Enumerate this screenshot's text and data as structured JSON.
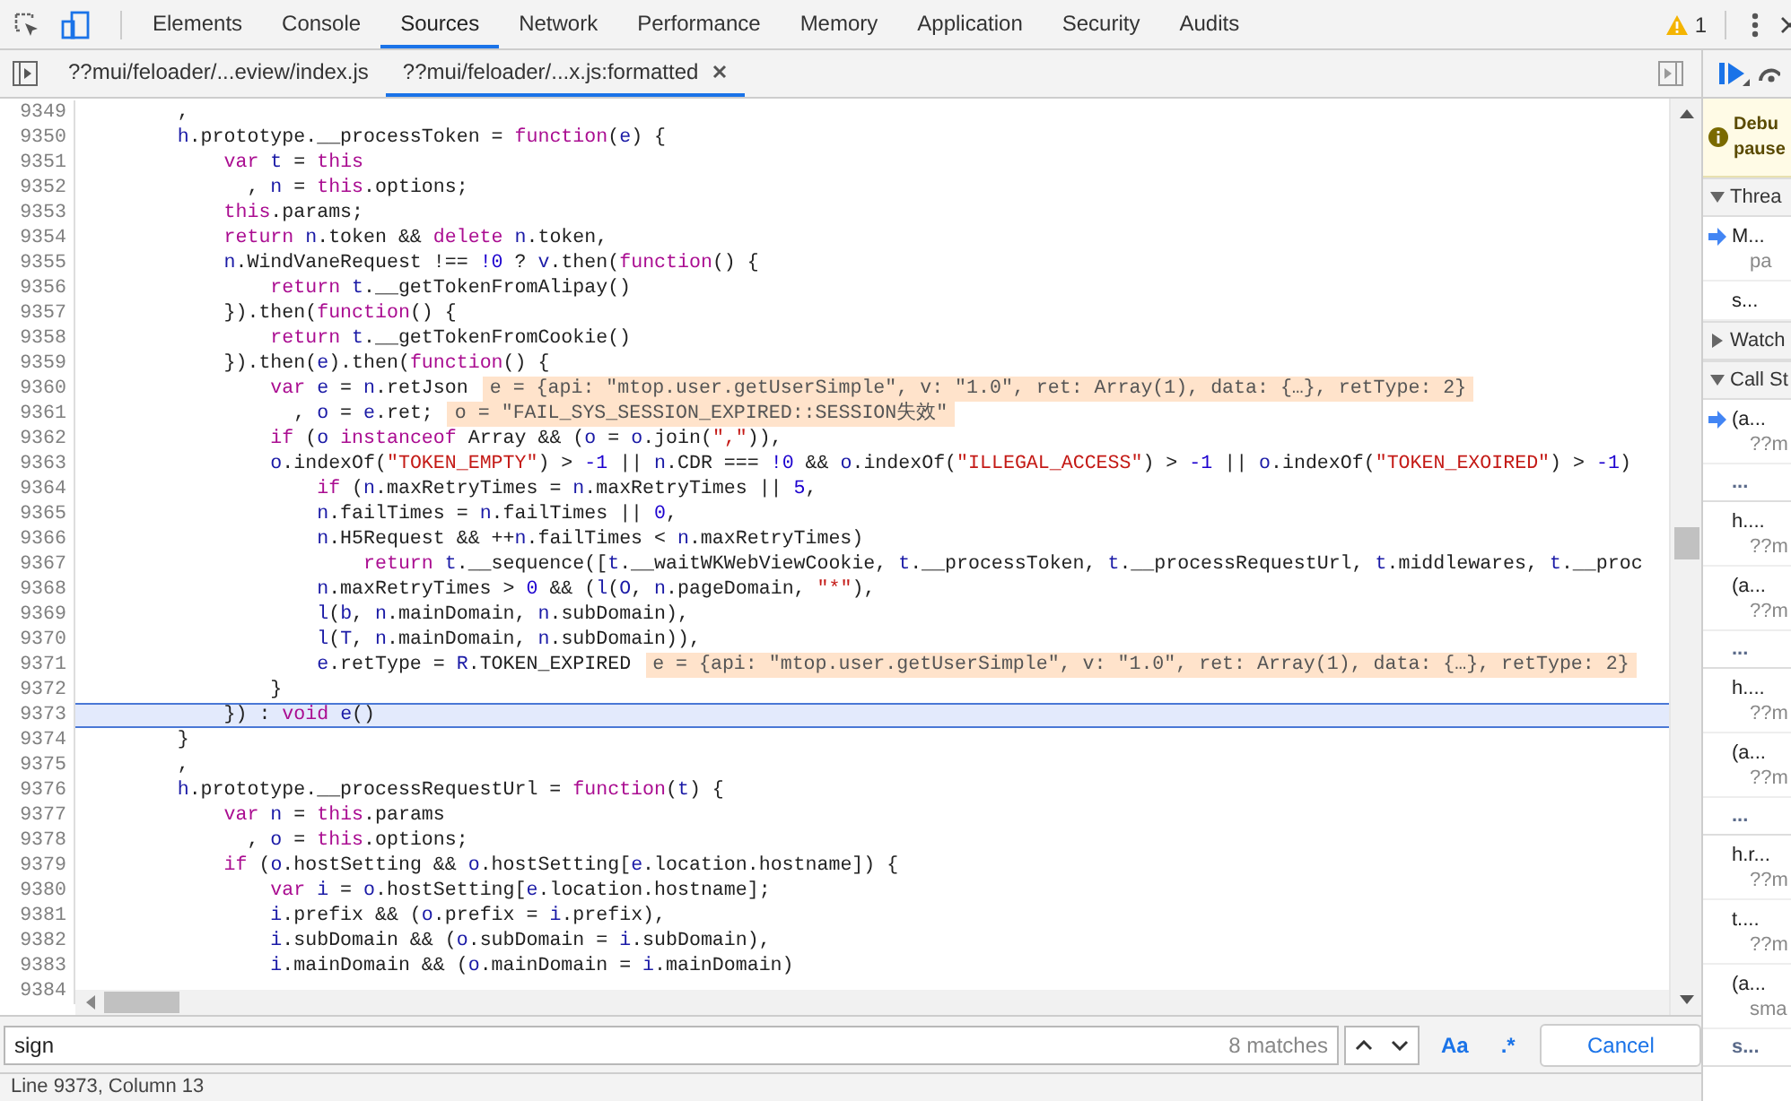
{
  "toolbar": {
    "device_mode_on": true,
    "tabs": [
      {
        "label": "Elements",
        "selected": false
      },
      {
        "label": "Console",
        "selected": false
      },
      {
        "label": "Sources",
        "selected": true
      },
      {
        "label": "Network",
        "selected": false
      },
      {
        "label": "Performance",
        "selected": false
      },
      {
        "label": "Memory",
        "selected": false
      },
      {
        "label": "Application",
        "selected": false
      },
      {
        "label": "Security",
        "selected": false
      },
      {
        "label": "Audits",
        "selected": false
      }
    ],
    "warning_count": "1"
  },
  "file_tabs": [
    {
      "label": "??mui/feloader/...eview/index.js",
      "selected": false
    },
    {
      "label": "??mui/feloader/...x.js:formatted",
      "selected": true
    }
  ],
  "code": [
    {
      "number": "9349",
      "current": false,
      "tokens": [
        {
          "kind": "p",
          "text": "        ,"
        }
      ]
    },
    {
      "number": "9350",
      "current": false,
      "tokens": [
        {
          "kind": "v",
          "text": "        h"
        },
        {
          "kind": "p",
          "text": ".prototype.__processToken = "
        },
        {
          "kind": "k",
          "text": "function"
        },
        {
          "kind": "p",
          "text": "("
        },
        {
          "kind": "v",
          "text": "e"
        },
        {
          "kind": "p",
          "text": ") {"
        }
      ]
    },
    {
      "number": "9351",
      "current": false,
      "tokens": [
        {
          "kind": "k",
          "text": "            var "
        },
        {
          "kind": "v",
          "text": "t"
        },
        {
          "kind": "p",
          "text": " = "
        },
        {
          "kind": "k",
          "text": "this"
        }
      ]
    },
    {
      "number": "9352",
      "current": false,
      "tokens": [
        {
          "kind": "p",
          "text": "              , "
        },
        {
          "kind": "v",
          "text": "n"
        },
        {
          "kind": "p",
          "text": " = "
        },
        {
          "kind": "k",
          "text": "this"
        },
        {
          "kind": "p",
          "text": ".options;"
        }
      ]
    },
    {
      "number": "9353",
      "current": false,
      "tokens": [
        {
          "kind": "k",
          "text": "            this"
        },
        {
          "kind": "p",
          "text": ".params;"
        }
      ]
    },
    {
      "number": "9354",
      "current": false,
      "tokens": [
        {
          "kind": "k",
          "text": "            return "
        },
        {
          "kind": "v",
          "text": "n"
        },
        {
          "kind": "p",
          "text": ".token && "
        },
        {
          "kind": "k",
          "text": "delete "
        },
        {
          "kind": "v",
          "text": "n"
        },
        {
          "kind": "p",
          "text": ".token,"
        }
      ]
    },
    {
      "number": "9355",
      "current": false,
      "tokens": [
        {
          "kind": "v",
          "text": "            n"
        },
        {
          "kind": "p",
          "text": ".WindVaneRequest !== "
        },
        {
          "kind": "n",
          "text": "!0"
        },
        {
          "kind": "p",
          "text": " ? "
        },
        {
          "kind": "v",
          "text": "v"
        },
        {
          "kind": "p",
          "text": ".then("
        },
        {
          "kind": "k",
          "text": "function"
        },
        {
          "kind": "p",
          "text": "() {"
        }
      ]
    },
    {
      "number": "9356",
      "current": false,
      "tokens": [
        {
          "kind": "k",
          "text": "                return "
        },
        {
          "kind": "v",
          "text": "t"
        },
        {
          "kind": "p",
          "text": ".__getTokenFromAlipay()"
        }
      ]
    },
    {
      "number": "9357",
      "current": false,
      "tokens": [
        {
          "kind": "p",
          "text": "            }).then("
        },
        {
          "kind": "k",
          "text": "function"
        },
        {
          "kind": "p",
          "text": "() {"
        }
      ]
    },
    {
      "number": "9358",
      "current": false,
      "tokens": [
        {
          "kind": "k",
          "text": "                return "
        },
        {
          "kind": "v",
          "text": "t"
        },
        {
          "kind": "p",
          "text": ".__getTokenFromCookie()"
        }
      ]
    },
    {
      "number": "9359",
      "current": false,
      "tokens": [
        {
          "kind": "p",
          "text": "            }).then("
        },
        {
          "kind": "v",
          "text": "e"
        },
        {
          "kind": "p",
          "text": ").then("
        },
        {
          "kind": "k",
          "text": "function"
        },
        {
          "kind": "p",
          "text": "() {"
        }
      ]
    },
    {
      "number": "9360",
      "current": false,
      "tokens": [
        {
          "kind": "k",
          "text": "                var "
        },
        {
          "kind": "v",
          "text": "e"
        },
        {
          "kind": "p",
          "text": " = "
        },
        {
          "kind": "v",
          "text": "n"
        },
        {
          "kind": "p",
          "text": ".retJson"
        }
      ],
      "inline_value": "e = {api: \"mtop.user.getUserSimple\", v: \"1.0\", ret: Array(1), data: {…}, retType: 2}"
    },
    {
      "number": "9361",
      "current": false,
      "tokens": [
        {
          "kind": "p",
          "text": "                  , "
        },
        {
          "kind": "v",
          "text": "o"
        },
        {
          "kind": "p",
          "text": " = "
        },
        {
          "kind": "v",
          "text": "e"
        },
        {
          "kind": "p",
          "text": ".ret;"
        }
      ],
      "inline_value": "o = \"FAIL_SYS_SESSION_EXPIRED::SESSION失效\""
    },
    {
      "number": "9362",
      "current": false,
      "tokens": [
        {
          "kind": "k",
          "text": "                if"
        },
        {
          "kind": "p",
          "text": " ("
        },
        {
          "kind": "v",
          "text": "o "
        },
        {
          "kind": "k",
          "text": "instanceof"
        },
        {
          "kind": "p",
          "text": " Array && ("
        },
        {
          "kind": "v",
          "text": "o"
        },
        {
          "kind": "p",
          "text": " = "
        },
        {
          "kind": "v",
          "text": "o"
        },
        {
          "kind": "p",
          "text": ".join("
        },
        {
          "kind": "s",
          "text": "\",\""
        },
        {
          "kind": "p",
          "text": ")),"
        }
      ]
    },
    {
      "number": "9363",
      "current": false,
      "tokens": [
        {
          "kind": "v",
          "text": "                o"
        },
        {
          "kind": "p",
          "text": ".indexOf("
        },
        {
          "kind": "s",
          "text": "\"TOKEN_EMPTY\""
        },
        {
          "kind": "p",
          "text": ") > "
        },
        {
          "kind": "n",
          "text": "-1"
        },
        {
          "kind": "p",
          "text": " || "
        },
        {
          "kind": "v",
          "text": "n"
        },
        {
          "kind": "p",
          "text": ".CDR === "
        },
        {
          "kind": "n",
          "text": "!0"
        },
        {
          "kind": "p",
          "text": " && "
        },
        {
          "kind": "v",
          "text": "o"
        },
        {
          "kind": "p",
          "text": ".indexOf("
        },
        {
          "kind": "s",
          "text": "\"ILLEGAL_ACCESS\""
        },
        {
          "kind": "p",
          "text": ") > "
        },
        {
          "kind": "n",
          "text": "-1"
        },
        {
          "kind": "p",
          "text": " || "
        },
        {
          "kind": "v",
          "text": "o"
        },
        {
          "kind": "p",
          "text": ".indexOf("
        },
        {
          "kind": "s",
          "text": "\"TOKEN_EXOIRED\""
        },
        {
          "kind": "p",
          "text": ") > "
        },
        {
          "kind": "n",
          "text": "-1"
        },
        {
          "kind": "p",
          "text": ")"
        }
      ]
    },
    {
      "number": "9364",
      "current": false,
      "tokens": [
        {
          "kind": "k",
          "text": "                    if"
        },
        {
          "kind": "p",
          "text": " ("
        },
        {
          "kind": "v",
          "text": "n"
        },
        {
          "kind": "p",
          "text": ".maxRetryTimes = "
        },
        {
          "kind": "v",
          "text": "n"
        },
        {
          "kind": "p",
          "text": ".maxRetryTimes || "
        },
        {
          "kind": "n",
          "text": "5"
        },
        {
          "kind": "p",
          "text": ","
        }
      ]
    },
    {
      "number": "9365",
      "current": false,
      "tokens": [
        {
          "kind": "v",
          "text": "                    n"
        },
        {
          "kind": "p",
          "text": ".failTimes = "
        },
        {
          "kind": "v",
          "text": "n"
        },
        {
          "kind": "p",
          "text": ".failTimes || "
        },
        {
          "kind": "n",
          "text": "0"
        },
        {
          "kind": "p",
          "text": ","
        }
      ]
    },
    {
      "number": "9366",
      "current": false,
      "tokens": [
        {
          "kind": "v",
          "text": "                    n"
        },
        {
          "kind": "p",
          "text": ".H5Request && ++"
        },
        {
          "kind": "v",
          "text": "n"
        },
        {
          "kind": "p",
          "text": ".failTimes < "
        },
        {
          "kind": "v",
          "text": "n"
        },
        {
          "kind": "p",
          "text": ".maxRetryTimes)"
        }
      ]
    },
    {
      "number": "9367",
      "current": false,
      "tokens": [
        {
          "kind": "k",
          "text": "                        return "
        },
        {
          "kind": "v",
          "text": "t"
        },
        {
          "kind": "p",
          "text": ".__sequence(["
        },
        {
          "kind": "v",
          "text": "t"
        },
        {
          "kind": "p",
          "text": ".__waitWKWebViewCookie, "
        },
        {
          "kind": "v",
          "text": "t"
        },
        {
          "kind": "p",
          "text": ".__processToken, "
        },
        {
          "kind": "v",
          "text": "t"
        },
        {
          "kind": "p",
          "text": ".__processRequestUrl, "
        },
        {
          "kind": "v",
          "text": "t"
        },
        {
          "kind": "p",
          "text": ".middlewares, "
        },
        {
          "kind": "v",
          "text": "t"
        },
        {
          "kind": "p",
          "text": ".__proc"
        }
      ]
    },
    {
      "number": "9368",
      "current": false,
      "tokens": [
        {
          "kind": "v",
          "text": "                    n"
        },
        {
          "kind": "p",
          "text": ".maxRetryTimes > "
        },
        {
          "kind": "n",
          "text": "0"
        },
        {
          "kind": "p",
          "text": " && ("
        },
        {
          "kind": "v",
          "text": "l"
        },
        {
          "kind": "p",
          "text": "("
        },
        {
          "kind": "v",
          "text": "O"
        },
        {
          "kind": "p",
          "text": ", "
        },
        {
          "kind": "v",
          "text": "n"
        },
        {
          "kind": "p",
          "text": ".pageDomain, "
        },
        {
          "kind": "s",
          "text": "\"*\""
        },
        {
          "kind": "p",
          "text": "),"
        }
      ]
    },
    {
      "number": "9369",
      "current": false,
      "tokens": [
        {
          "kind": "v",
          "text": "                    l"
        },
        {
          "kind": "p",
          "text": "("
        },
        {
          "kind": "v",
          "text": "b"
        },
        {
          "kind": "p",
          "text": ", "
        },
        {
          "kind": "v",
          "text": "n"
        },
        {
          "kind": "p",
          "text": ".mainDomain, "
        },
        {
          "kind": "v",
          "text": "n"
        },
        {
          "kind": "p",
          "text": ".subDomain),"
        }
      ]
    },
    {
      "number": "9370",
      "current": false,
      "tokens": [
        {
          "kind": "v",
          "text": "                    l"
        },
        {
          "kind": "p",
          "text": "("
        },
        {
          "kind": "v",
          "text": "T"
        },
        {
          "kind": "p",
          "text": ", "
        },
        {
          "kind": "v",
          "text": "n"
        },
        {
          "kind": "p",
          "text": ".mainDomain, "
        },
        {
          "kind": "v",
          "text": "n"
        },
        {
          "kind": "p",
          "text": ".subDomain)),"
        }
      ]
    },
    {
      "number": "9371",
      "current": false,
      "tokens": [
        {
          "kind": "v",
          "text": "                    e"
        },
        {
          "kind": "p",
          "text": ".retType = "
        },
        {
          "kind": "v",
          "text": "R"
        },
        {
          "kind": "p",
          "text": ".TOKEN_EXPIRED"
        }
      ],
      "inline_value": "e = {api: \"mtop.user.getUserSimple\", v: \"1.0\", ret: Array(1), data: {…}, retType: 2}"
    },
    {
      "number": "9372",
      "current": false,
      "tokens": [
        {
          "kind": "p",
          "text": "                }"
        }
      ]
    },
    {
      "number": "9373",
      "current": true,
      "tokens": [
        {
          "kind": "p",
          "text": "            }) : "
        },
        {
          "kind": "k",
          "text": "void "
        },
        {
          "kind": "v",
          "text": "e"
        },
        {
          "kind": "p",
          "text": "()"
        }
      ]
    },
    {
      "number": "9374",
      "current": false,
      "tokens": [
        {
          "kind": "p",
          "text": "        }"
        }
      ]
    },
    {
      "number": "9375",
      "current": false,
      "tokens": [
        {
          "kind": "p",
          "text": "        ,"
        }
      ]
    },
    {
      "number": "9376",
      "current": false,
      "tokens": [
        {
          "kind": "v",
          "text": "        h"
        },
        {
          "kind": "p",
          "text": ".prototype.__processRequestUrl = "
        },
        {
          "kind": "k",
          "text": "function"
        },
        {
          "kind": "p",
          "text": "("
        },
        {
          "kind": "v",
          "text": "t"
        },
        {
          "kind": "p",
          "text": ") {"
        }
      ]
    },
    {
      "number": "9377",
      "current": false,
      "tokens": [
        {
          "kind": "k",
          "text": "            var "
        },
        {
          "kind": "v",
          "text": "n"
        },
        {
          "kind": "p",
          "text": " = "
        },
        {
          "kind": "k",
          "text": "this"
        },
        {
          "kind": "p",
          "text": ".params"
        }
      ]
    },
    {
      "number": "9378",
      "current": false,
      "tokens": [
        {
          "kind": "p",
          "text": "              , "
        },
        {
          "kind": "v",
          "text": "o"
        },
        {
          "kind": "p",
          "text": " = "
        },
        {
          "kind": "k",
          "text": "this"
        },
        {
          "kind": "p",
          "text": ".options;"
        }
      ]
    },
    {
      "number": "9379",
      "current": false,
      "tokens": [
        {
          "kind": "k",
          "text": "            if"
        },
        {
          "kind": "p",
          "text": " ("
        },
        {
          "kind": "v",
          "text": "o"
        },
        {
          "kind": "p",
          "text": ".hostSetting && "
        },
        {
          "kind": "v",
          "text": "o"
        },
        {
          "kind": "p",
          "text": ".hostSetting["
        },
        {
          "kind": "v",
          "text": "e"
        },
        {
          "kind": "p",
          "text": ".location.hostname]) {"
        }
      ]
    },
    {
      "number": "9380",
      "current": false,
      "tokens": [
        {
          "kind": "k",
          "text": "                var "
        },
        {
          "kind": "v",
          "text": "i"
        },
        {
          "kind": "p",
          "text": " = "
        },
        {
          "kind": "v",
          "text": "o"
        },
        {
          "kind": "p",
          "text": ".hostSetting["
        },
        {
          "kind": "v",
          "text": "e"
        },
        {
          "kind": "p",
          "text": ".location.hostname];"
        }
      ]
    },
    {
      "number": "9381",
      "current": false,
      "tokens": [
        {
          "kind": "v",
          "text": "                i"
        },
        {
          "kind": "p",
          "text": ".prefix && ("
        },
        {
          "kind": "v",
          "text": "o"
        },
        {
          "kind": "p",
          "text": ".prefix = "
        },
        {
          "kind": "v",
          "text": "i"
        },
        {
          "kind": "p",
          "text": ".prefix),"
        }
      ]
    },
    {
      "number": "9382",
      "current": false,
      "tokens": [
        {
          "kind": "v",
          "text": "                i"
        },
        {
          "kind": "p",
          "text": ".subDomain && ("
        },
        {
          "kind": "v",
          "text": "o"
        },
        {
          "kind": "p",
          "text": ".subDomain = "
        },
        {
          "kind": "v",
          "text": "i"
        },
        {
          "kind": "p",
          "text": ".subDomain),"
        }
      ]
    },
    {
      "number": "9383",
      "current": false,
      "tokens": [
        {
          "kind": "v",
          "text": "                i"
        },
        {
          "kind": "p",
          "text": ".mainDomain && ("
        },
        {
          "kind": "v",
          "text": "o"
        },
        {
          "kind": "p",
          "text": ".mainDomain = "
        },
        {
          "kind": "v",
          "text": "i"
        },
        {
          "kind": "p",
          "text": ".mainDomain)"
        }
      ]
    },
    {
      "number": "9384",
      "current": false
    }
  ],
  "search": {
    "value": "sign",
    "match_count": "8 matches",
    "options": [
      "Aa",
      ".*"
    ],
    "cancel": "Cancel"
  },
  "status_bar": "Line 9373, Column 13",
  "debugger_sidebar": {
    "paused_banner": [
      "Debu",
      "pause"
    ],
    "sections": [
      {
        "title": "Threa",
        "expanded": true,
        "items": [
          {
            "kind": "item",
            "name": "M...",
            "location": "pa",
            "selected": true
          },
          {
            "kind": "item",
            "name": "s...",
            "selected": false
          }
        ]
      },
      {
        "title": "Watch",
        "expanded": false
      },
      {
        "title": "Call St",
        "expanded": true,
        "items": [
          {
            "kind": "item",
            "name": "(a...",
            "location": "??m",
            "selected": true
          },
          {
            "kind": "async",
            "name": "..."
          },
          {
            "kind": "item",
            "name": "h....",
            "location": "??m",
            "selected": false
          },
          {
            "kind": "item",
            "name": "(a...",
            "location": "??m",
            "selected": false
          },
          {
            "kind": "async",
            "name": "..."
          },
          {
            "kind": "item",
            "name": "h....",
            "location": "??m",
            "selected": false
          },
          {
            "kind": "item",
            "name": "(a...",
            "location": "??m",
            "selected": false
          },
          {
            "kind": "async",
            "name": "..."
          },
          {
            "kind": "item",
            "name": "h.r...",
            "location": "??m",
            "selected": false
          },
          {
            "kind": "item",
            "name": "t....",
            "location": "??m",
            "selected": false
          },
          {
            "kind": "item",
            "name": "(a...",
            "location": "sma",
            "selected": false
          },
          {
            "kind": "async",
            "name": "s..."
          }
        ]
      }
    ]
  }
}
